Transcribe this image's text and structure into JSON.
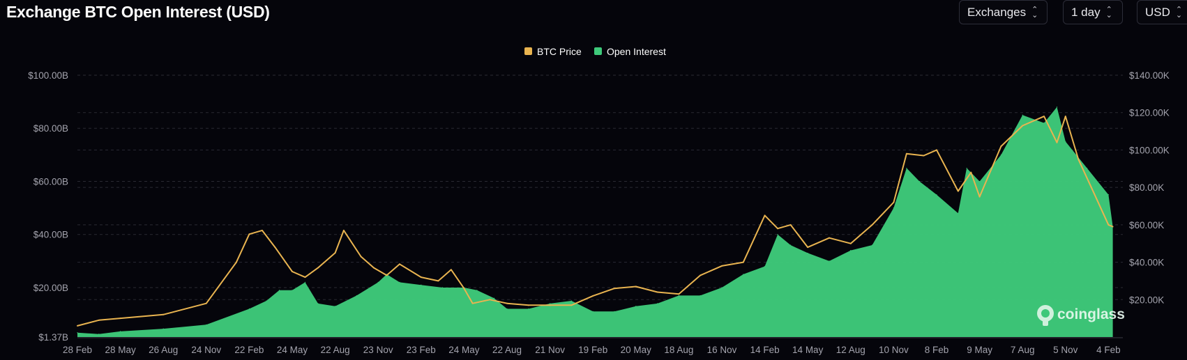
{
  "title": "Exchange BTC Open Interest (USD)",
  "controls": {
    "exchanges_label": "Exchanges",
    "interval_label": "1 day",
    "currency_label": "USD"
  },
  "watermark": "coinglass",
  "colors": {
    "background": "#05050b",
    "btc_price": "#e9b450",
    "open_interest": "#3ec97a",
    "grid": "#2a2a33",
    "tick": "#a3a3ad"
  },
  "chart_data": {
    "type": "area",
    "legend": [
      "BTC Price",
      "Open Interest"
    ],
    "legend_position": "top-center",
    "grid": true,
    "x_tick_labels": [
      "28 Feb",
      "28 May",
      "26 Aug",
      "24 Nov",
      "22 Feb",
      "24 May",
      "22 Aug",
      "23 Nov",
      "23 Feb",
      "24 May",
      "22 Aug",
      "21 Nov",
      "19 Feb",
      "20 May",
      "18 Aug",
      "16 Nov",
      "14 Feb",
      "14 May",
      "12 Aug",
      "10 Nov",
      "8 Feb",
      "9 May",
      "7 Aug",
      "5 Nov",
      "4 Feb"
    ],
    "y_left": {
      "label": "",
      "range": [
        1.37,
        100
      ],
      "tick_values": [
        1.37,
        20,
        40,
        60,
        80,
        100
      ],
      "tick_labels": [
        "$1.37B",
        "$20.00B",
        "$40.00B",
        "$60.00B",
        "$80.00B",
        "$100.00B"
      ]
    },
    "y_right": {
      "label": "",
      "range": [
        0,
        140
      ],
      "tick_values": [
        20,
        40,
        60,
        80,
        100,
        120,
        140
      ],
      "tick_labels": [
        "$20.00K",
        "$40.00K",
        "$60.00K",
        "$80.00K",
        "$100.00K",
        "$120.00K",
        "$140.00K"
      ]
    },
    "series": [
      {
        "name": "Open Interest",
        "axis": "left",
        "unit": "B USD",
        "x_index": [
          0,
          0.5,
          1,
          2,
          3,
          4,
          4.4,
          4.7,
          5,
          5.3,
          5.6,
          6,
          6.5,
          7,
          7.2,
          7.5,
          8,
          8.5,
          9,
          9.3,
          9.7,
          10,
          10.5,
          11,
          11.5,
          12,
          12.5,
          13,
          13.5,
          14,
          14.5,
          15,
          15.5,
          16,
          16.3,
          16.6,
          17,
          17.5,
          18,
          18.5,
          19,
          19.3,
          19.6,
          20,
          20.5,
          20.7,
          21,
          21.5,
          22,
          22.5,
          22.8,
          23,
          23.5,
          24,
          24.1
        ],
        "values": [
          3,
          2.5,
          3.5,
          4.5,
          6,
          12,
          15,
          19,
          19,
          22,
          14,
          13,
          17,
          22,
          25,
          22,
          21,
          20,
          20,
          19,
          16,
          12,
          12,
          14,
          15,
          11,
          11,
          13,
          14,
          17,
          17,
          20,
          25,
          28,
          40,
          36,
          33,
          30,
          34,
          36,
          50,
          65,
          60,
          55,
          48,
          65,
          60,
          70,
          85,
          82,
          88,
          75,
          65,
          55,
          43
        ]
      },
      {
        "name": "BTC Price",
        "axis": "right",
        "unit": "K USD",
        "x_index": [
          0,
          0.5,
          1,
          2,
          3,
          3.7,
          4,
          4.3,
          4.6,
          5,
          5.3,
          5.6,
          6,
          6.2,
          6.6,
          6.9,
          7.2,
          7.5,
          8,
          8.4,
          8.7,
          9,
          9.2,
          9.6,
          10,
          10.5,
          11,
          11.5,
          12,
          12.5,
          13,
          13.5,
          14,
          14.5,
          15,
          15.5,
          16,
          16.3,
          16.6,
          17,
          17.5,
          18,
          18.5,
          19,
          19.3,
          19.7,
          20,
          20.5,
          20.8,
          21,
          21.5,
          22,
          22.5,
          22.8,
          23,
          23.3,
          23.6,
          24,
          24.1
        ],
        "values": [
          6,
          9,
          10,
          12,
          18,
          40,
          55,
          57,
          48,
          35,
          32,
          37,
          45,
          57,
          43,
          37,
          33,
          39,
          32,
          30,
          36,
          26,
          18,
          20,
          18,
          17,
          17,
          17,
          22,
          26,
          27,
          24,
          23,
          33,
          38,
          40,
          65,
          58,
          60,
          48,
          53,
          50,
          60,
          72,
          98,
          97,
          100,
          78,
          88,
          75,
          102,
          113,
          118,
          104,
          118,
          95,
          80,
          60,
          59
        ]
      }
    ]
  }
}
